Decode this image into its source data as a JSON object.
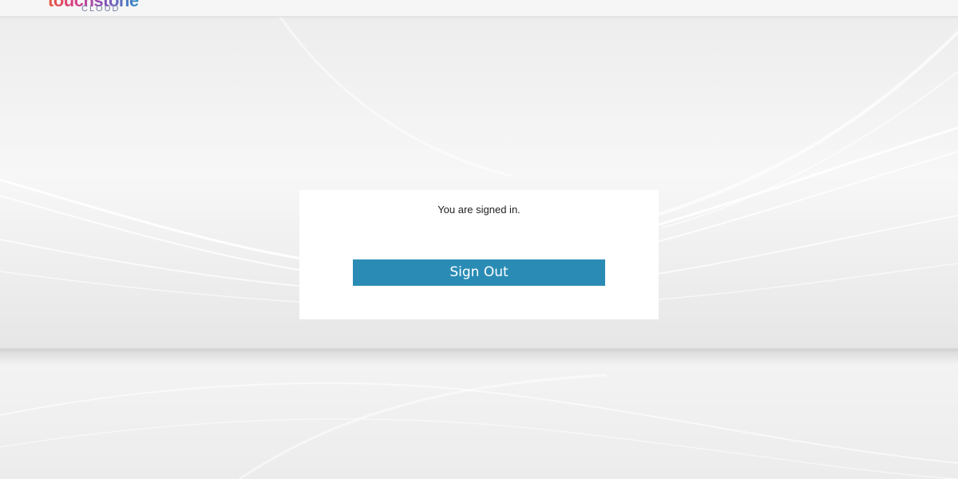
{
  "header": {
    "logo": {
      "wordmark": "touchstone",
      "subtitle": "CLOUD"
    }
  },
  "panel": {
    "message": "You are signed in.",
    "sign_out_label": "Sign Out"
  },
  "colors": {
    "button": "#2a8cb5",
    "button_text": "#ffffff",
    "panel_bg": "#ffffff"
  }
}
